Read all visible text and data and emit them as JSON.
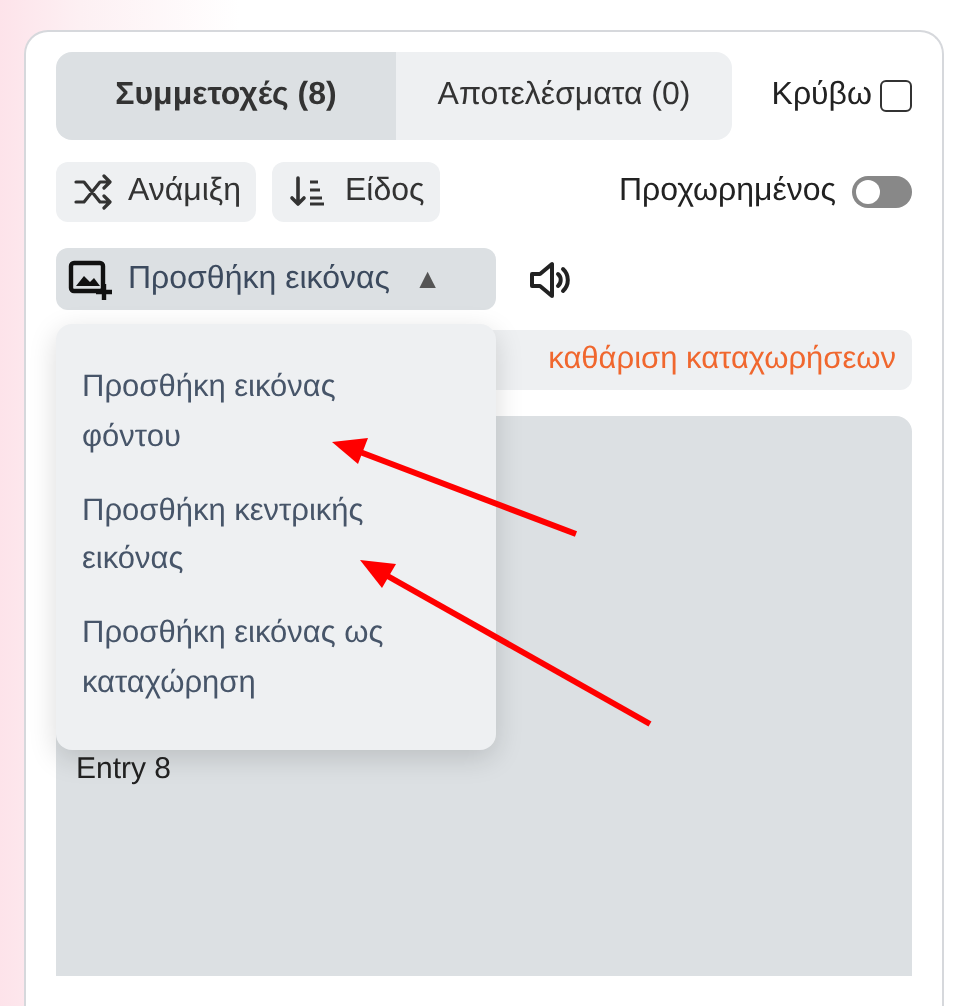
{
  "tabs": [
    {
      "label": "Συμμετοχές (8)",
      "selected": true
    },
    {
      "label": "Αποτελέσματα (0)",
      "selected": false
    }
  ],
  "hide": {
    "label": "Κρύβω",
    "checked": false
  },
  "toolbar": [
    {
      "label": "Ανάμιξη",
      "kind": "shuffle"
    },
    {
      "label": "Είδος",
      "kind": "sort"
    }
  ],
  "advanced": {
    "label": "Προχωρημένος",
    "on": false
  },
  "add_image": {
    "label": "Προσθήκη εικόνας",
    "caret": "▲",
    "expanded": true
  },
  "clear_button": {
    "label": "καθάριση καταχωρήσεων"
  },
  "menu": {
    "items": [
      {
        "label": "Προσθήκη εικόνας φόντου"
      },
      {
        "label": "Προσθήκη κεντρικής εικόνας"
      },
      {
        "label": "Προσθήκη εικόνας ως καταχώρηση"
      }
    ]
  },
  "entries": [
    {
      "label": "Entry 8"
    }
  ]
}
